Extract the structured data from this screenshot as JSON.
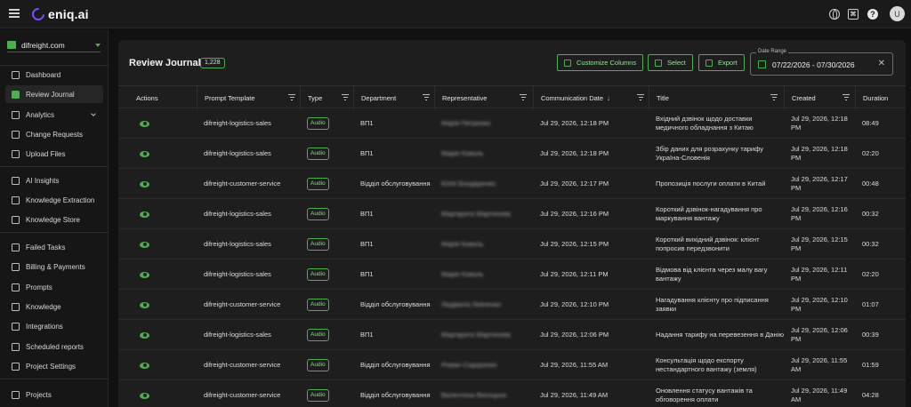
{
  "app": {
    "logo_text": "eniq.ai"
  },
  "topbar": {
    "translate_glyph": "⌘",
    "help_glyph": "?",
    "avatar_initial": "U"
  },
  "sidebar": {
    "org": "difreight.com",
    "items": [
      {
        "label": "Dashboard",
        "icon": "dashboard-icon"
      },
      {
        "label": "Review Journal",
        "icon": "journal-icon",
        "active": true
      },
      {
        "label": "Analytics",
        "icon": "analytics-icon",
        "expandable": true
      },
      {
        "label": "Change Requests",
        "icon": "change-requests-icon"
      },
      {
        "label": "Upload Files",
        "icon": "upload-icon"
      },
      {
        "label": "AI Insights",
        "icon": "ai-insights-icon"
      },
      {
        "label": "Knowledge Extraction",
        "icon": "knowledge-extraction-icon"
      },
      {
        "label": "Knowledge Store",
        "icon": "knowledge-store-icon"
      },
      {
        "label": "Failed Tasks",
        "icon": "warning-icon"
      },
      {
        "label": "Billing & Payments",
        "icon": "bank-icon"
      },
      {
        "label": "Prompts",
        "icon": "prompts-icon"
      },
      {
        "label": "Knowledge",
        "icon": "book-icon"
      },
      {
        "label": "Integrations",
        "icon": "integrations-icon"
      },
      {
        "label": "Scheduled reports",
        "icon": "clock-icon"
      },
      {
        "label": "Project Settings",
        "icon": "settings-icon"
      },
      {
        "label": "Projects",
        "icon": "folder-icon"
      }
    ]
  },
  "main": {
    "title": "Review Journal",
    "count": "1,228",
    "buttons": {
      "customize": "Customize Columns",
      "select": "Select",
      "export": "Export"
    },
    "date_range": {
      "label": "Date Range",
      "value": "07/22/2026 - 07/30/2026",
      "clear": "✕"
    }
  },
  "table": {
    "columns": [
      "Actions",
      "Prompt Template",
      "Type",
      "Department",
      "Representative",
      "Communication Date",
      "Title",
      "Created",
      "Duration"
    ],
    "sort_glyph": "↓",
    "rows": [
      {
        "template": "difreight-logistics-sales",
        "type": "Audio",
        "department": "ВП1",
        "rep": "Марія Петренко",
        "date": "Jul 29, 2026, 12:18 PM",
        "title": "Вхідний дзвінок щодо доставки медичного обладнання з Китаю",
        "created": "Jul 29, 2026, 12:18 PM",
        "duration": "08:49"
      },
      {
        "template": "difreight-logistics-sales",
        "type": "Audio",
        "department": "ВП1",
        "rep": "Марія Коваль",
        "date": "Jul 29, 2026, 12:18 PM",
        "title": "Збір даних для розрахунку тарифу Україна-Словенія",
        "created": "Jul 29, 2026, 12:18 PM",
        "duration": "02:20"
      },
      {
        "template": "difreight-customer-service",
        "type": "Audio",
        "department": "Відділ обслуговування",
        "rep": "Юлія Бондаренко",
        "date": "Jul 29, 2026, 12:17 PM",
        "title": "Пропозиція послуги оплати в Китай",
        "created": "Jul 29, 2026, 12:17 PM",
        "duration": "00:48"
      },
      {
        "template": "difreight-logistics-sales",
        "type": "Audio",
        "department": "ВП1",
        "rep": "Маргарита Мартинова",
        "date": "Jul 29, 2026, 12:16 PM",
        "title": "Короткий дзвінок-нагадування про маркування вантажу",
        "created": "Jul 29, 2026, 12:16 PM",
        "duration": "00:32"
      },
      {
        "template": "difreight-logistics-sales",
        "type": "Audio",
        "department": "ВП1",
        "rep": "Марія Коваль",
        "date": "Jul 29, 2026, 12:15 PM",
        "title": "Короткий вихідний дзвінок: клієнт попросив передзвонити",
        "created": "Jul 29, 2026, 12:15 PM",
        "duration": "00:32"
      },
      {
        "template": "difreight-logistics-sales",
        "type": "Audio",
        "department": "ВП1",
        "rep": "Марія Коваль",
        "date": "Jul 29, 2026, 12:11 PM",
        "title": "Відмова від клієнта через малу вагу вантажу",
        "created": "Jul 29, 2026, 12:11 PM",
        "duration": "02:20"
      },
      {
        "template": "difreight-customer-service",
        "type": "Audio",
        "department": "Відділ обслуговування",
        "rep": "Людмила Левченко",
        "date": "Jul 29, 2026, 12:10 PM",
        "title": "Нагадування клієнту про підписання заявки",
        "created": "Jul 29, 2026, 12:10 PM",
        "duration": "01:07"
      },
      {
        "template": "difreight-logistics-sales",
        "type": "Audio",
        "department": "ВП1",
        "rep": "Маргарита Мартинова",
        "date": "Jul 29, 2026, 12:06 PM",
        "title": "Надання тарифу на перевезення в Данію",
        "created": "Jul 29, 2026, 12:06 PM",
        "duration": "00:39"
      },
      {
        "template": "difreight-customer-service",
        "type": "Audio",
        "department": "Відділ обслуговування",
        "rep": "Роман Сидоренко",
        "date": "Jul 29, 2026, 11:55 AM",
        "title": "Консультація щодо експорту нестандартного вантажу (земля)",
        "created": "Jul 29, 2026, 11:55 AM",
        "duration": "01:59"
      },
      {
        "template": "difreight-customer-service",
        "type": "Audio",
        "department": "Відділ обслуговування",
        "rep": "Валентина Висоцька",
        "date": "Jul 29, 2026, 11:49 AM",
        "title": "Оновлення статусу вантажів та обговорення оплати",
        "created": "Jul 29, 2026, 11:49 AM",
        "duration": "04:28"
      }
    ]
  }
}
